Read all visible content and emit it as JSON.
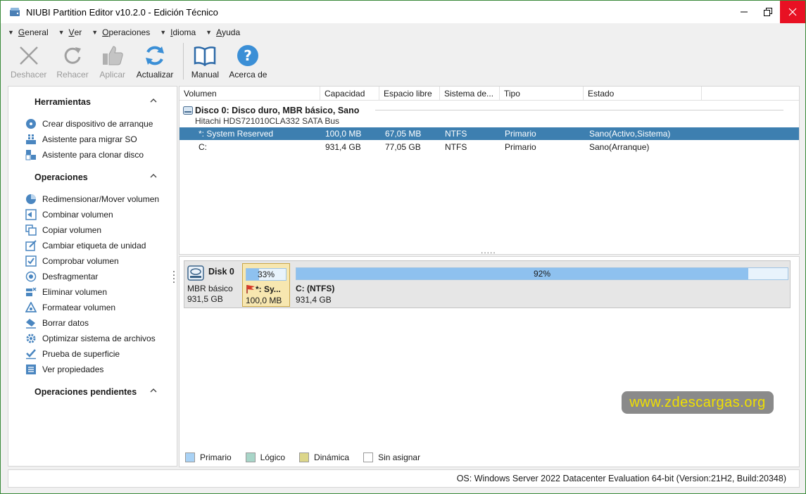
{
  "window": {
    "title": "NIUBI Partition Editor v10.2.0 - Edición Técnico"
  },
  "menu": [
    {
      "label": "General",
      "key": "G",
      "rest": "eneral"
    },
    {
      "label": "Ver",
      "key": "V",
      "rest": "er"
    },
    {
      "label": "Operaciones",
      "key": "O",
      "rest": "peraciones"
    },
    {
      "label": "Idioma",
      "key": "I",
      "rest": "dioma"
    },
    {
      "label": "Ayuda",
      "key": "A",
      "rest": "yuda"
    }
  ],
  "toolbar": {
    "undo": "Deshacer",
    "redo": "Rehacer",
    "apply": "Aplicar",
    "refresh": "Actualizar",
    "manual": "Manual",
    "about": "Acerca de"
  },
  "sidebar": {
    "tools": {
      "title": "Herramientas",
      "items": [
        "Crear dispositivo de arranque",
        "Asistente para migrar SO",
        "Asistente para clonar disco"
      ]
    },
    "operations": {
      "title": "Operaciones",
      "items": [
        "Redimensionar/Mover volumen",
        "Combinar volumen",
        "Copiar volumen",
        "Cambiar etiqueta de unidad",
        "Comprobar volumen",
        "Desfragmentar",
        "Eliminar volumen",
        "Formatear volumen",
        "Borrar datos",
        "Optimizar sistema de archivos",
        "Prueba de superficie",
        "Ver propiedades"
      ]
    },
    "pending": {
      "title": "Operaciones pendientes"
    }
  },
  "grid": {
    "columns": [
      "Volumen",
      "Capacidad",
      "Espacio libre",
      "Sistema de...",
      "Tipo",
      "Estado"
    ],
    "disk": {
      "title": "Disco 0: Disco duro, MBR básico, Sano",
      "subtitle": "Hitachi HDS721010CLA332 SATA Bus"
    },
    "rows": [
      {
        "volume": "*: System Reserved",
        "capacity": "100,0 MB",
        "free": "67,05 MB",
        "fs": "NTFS",
        "type": "Primario",
        "status": "Sano(Activo,Sistema)"
      },
      {
        "volume": "C:",
        "capacity": "931,4 GB",
        "free": "77,05 GB",
        "fs": "NTFS",
        "type": "Primario",
        "status": "Sano(Arranque)"
      }
    ],
    "dots": "....."
  },
  "diskmap": {
    "disk_name": "Disk 0",
    "disk_type": "MBR básico",
    "disk_size": "931,5 GB",
    "partitions": [
      {
        "pct_label": "33%",
        "used_fraction": 0.33,
        "label": "*: Sy...",
        "size": "100,0 MB"
      },
      {
        "pct_label": "92%",
        "used_fraction": 0.92,
        "label": "C: (NTFS)",
        "size": "931,4 GB"
      }
    ]
  },
  "watermark": "www.zdescargas.org",
  "legend": [
    {
      "label": "Primario",
      "color": "#a9d2f5"
    },
    {
      "label": "Lógico",
      "color": "#a8d5c8"
    },
    {
      "label": "Dinámica",
      "color": "#dcd68a"
    },
    {
      "label": "Sin asignar",
      "color": "#ffffff"
    }
  ],
  "status": "OS: Windows Server 2022 Datacenter Evaluation 64-bit (Version:21H2, Build:20348)",
  "colors": {
    "selection": "#3d7fb0",
    "close": "#e81123",
    "usage_fill": "#8ec1ef"
  }
}
